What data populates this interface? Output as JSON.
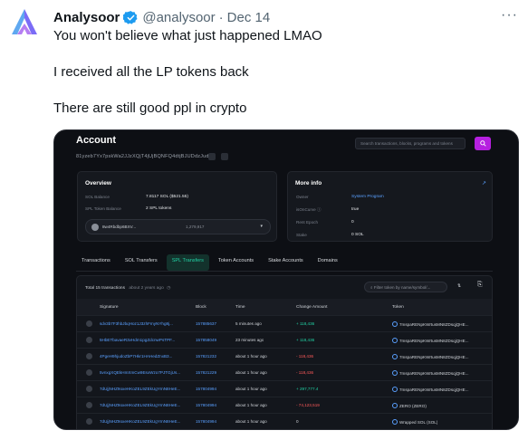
{
  "tweet": {
    "display_name": "Analysoor",
    "handle": "@analysoor",
    "separator": "·",
    "date": "Dec 14",
    "more": "···",
    "lines": [
      "You won't believe what just happened LMAO",
      "I received all the LP tokens back",
      "There are still good ppl in crypto"
    ]
  },
  "shot": {
    "title": "Account",
    "address": "81yzeb7Yx7pskWa2JJzXQjT4jUjBQNFQ4dtjBJUDdzJud",
    "search_placeholder": "Search transactions, blocks, programs and tokens",
    "overview": {
      "title": "Overview",
      "sol_balance_label": "SOL Balance",
      "sol_balance_value": "7.8117 SOL ($521.55)",
      "spl_label": "SPL Token Balance",
      "spl_value": "2 SPL tokens",
      "token_select_name": "8w4Rbdbp6BXV...",
      "token_select_amount": "1,279,917"
    },
    "more_info": {
      "title": "More info",
      "owner_label": "Owner",
      "owner_value": "System Program",
      "isoncurve_label": "isOnCurve ⓘ",
      "isoncurve_value": "true",
      "rent_label": "Rent Epoch",
      "rent_value": "0",
      "stake_label": "Stake",
      "stake_value": "0 SOL"
    },
    "tabs": [
      "Transactions",
      "SOL Transfers",
      "SPL Transfers",
      "Token Accounts",
      "Stake Accounts",
      "Domains"
    ],
    "active_tab": "SPL Transfers",
    "table": {
      "total": "Total 15 transactions",
      "total_time": "about 2 years ago",
      "filter_placeholder": "Filter token by name/symbol/...",
      "filter_icon": "filter-icon",
      "headers": [
        "Signature",
        "Block",
        "Time",
        "Change Amount",
        "Token"
      ],
      "rows": [
        {
          "sig": "sdv3b7F3hbJbqHoz1J3zhFmyNYhg8j...",
          "block": "157885637",
          "time": "5 minutes ago",
          "amount": "+ 118,436",
          "kind": "pos",
          "token": "7mspaRENpKWrtusMN8ZDsqjQHE..."
        },
        {
          "sig": "5HbETbavaeR3vHdm1pgZdcnwPsTPF...",
          "block": "157858049",
          "time": "23 minutes ago",
          "amount": "+ 118,436",
          "kind": "pos",
          "token": "7mspaRENpKWrtusMN8ZDsqjQHE..."
        },
        {
          "sig": "4PgeH9hjudoZbP7Hkr1HAHedZnxB3...",
          "block": "157821232",
          "time": "about 1 hour ago",
          "amount": "- 118,436",
          "kind": "neg",
          "token": "7mspaRENpKWrtusMN8ZDsqjQHE..."
        },
        {
          "sig": "5vnxgXQEkHmXmCw9EsxWzo7PJTGjUs...",
          "block": "157821229",
          "time": "about 1 hour ago",
          "amount": "- 118,436",
          "kind": "neg",
          "token": "7mspaRENpKWrtusMN8ZDsqjQHE..."
        },
        {
          "sig": "7dUjjNHZ9oxeHKoZEL9ZEkUgYmN8HeE...",
          "block": "157804994",
          "time": "about 1 hour ago",
          "amount": "+ 297,777.4",
          "kind": "pos",
          "token": "7mspaRENpKWrtusMN8ZDsqjQHE..."
        },
        {
          "sig": "7dUjjNHZ9oxeHKoZEL9ZEkUgYmN8HeE...",
          "block": "157804994",
          "time": "about 1 hour ago",
          "amount": "- 74,123,519",
          "kind": "neg",
          "token": "ZERO (ZERO)"
        },
        {
          "sig": "7dUjjNHZ9oxeHKoZEL9ZEkUgYmN8HeE...",
          "block": "157804994",
          "time": "about 1 hour ago",
          "amount": "0",
          "kind": "neu",
          "token": "Wrapped SOL (SOL)"
        }
      ]
    }
  }
}
